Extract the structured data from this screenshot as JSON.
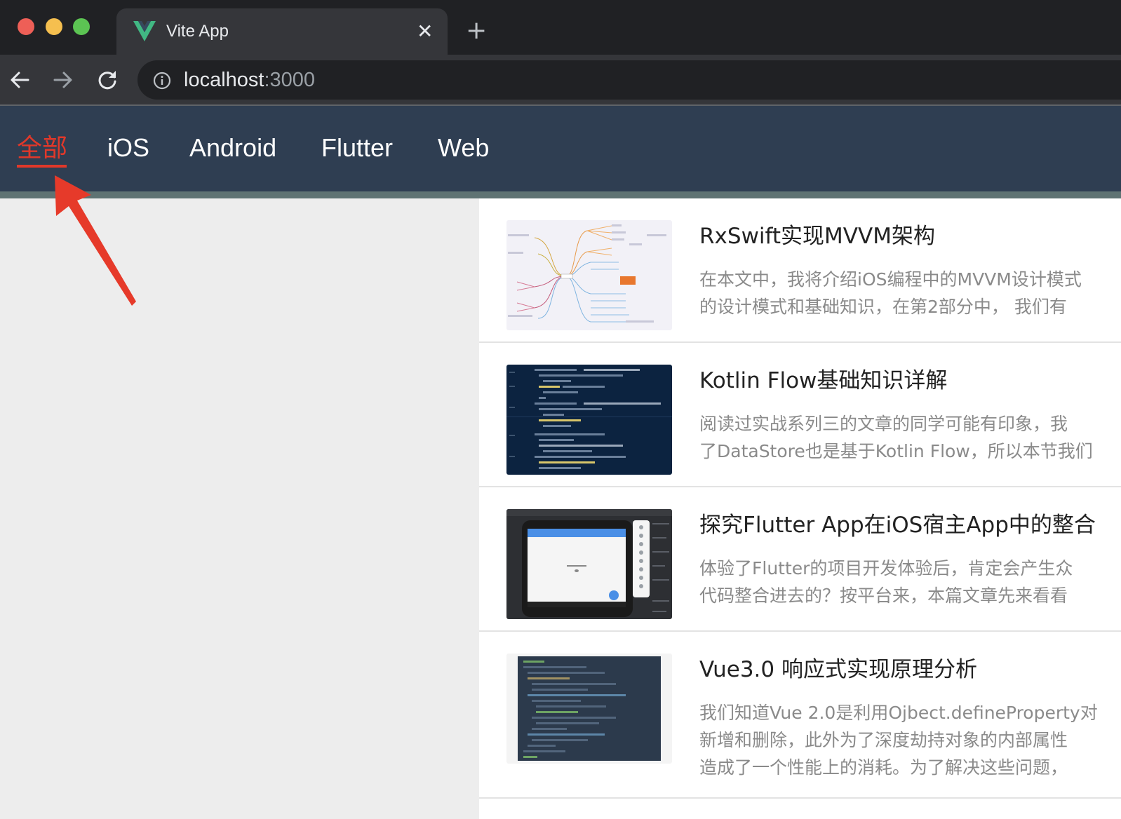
{
  "browser": {
    "tab_title": "Vite App",
    "url_host": "localhost",
    "url_port": ":3000",
    "close_glyph": "✕",
    "new_tab_glyph": "+"
  },
  "nav": {
    "items": [
      {
        "label": "全部",
        "active": true
      },
      {
        "label": "iOS",
        "active": false
      },
      {
        "label": "Android",
        "active": false
      },
      {
        "label": "Flutter",
        "active": false
      },
      {
        "label": "Web",
        "active": false
      }
    ],
    "active_color": "#e0382a",
    "background": "#2f3e52"
  },
  "annotation": {
    "icon": "red-arrow-icon",
    "color": "#e63a2a"
  },
  "articles": [
    {
      "title": "RxSwift实现MVVM架构",
      "desc_lines": [
        "在本文中，我将介绍iOS编程中的MVVM设计模式",
        "的设计模式和基础知识，在第2部分中， 我们有"
      ],
      "thumb": "mindmap"
    },
    {
      "title": "Kotlin Flow基础知识详解",
      "desc_lines": [
        "阅读过实战系列三的文章的同学可能有印象，我",
        "了DataStore也是基于Kotlin Flow，所以本节我们"
      ],
      "thumb": "code-editor"
    },
    {
      "title": "探究Flutter App在iOS宿主App中的整合",
      "desc_lines": [
        "体验了Flutter的项目开发体验后，肯定会产生众",
        "代码整合进去的？按平台来，本篇文章先来看看"
      ],
      "thumb": "phone-emulator"
    },
    {
      "title": "Vue3.0 响应式实现原理分析",
      "desc_lines": [
        "我们知道Vue 2.0是利用Ojbect.defineProperty对",
        "新增和删除，此外为了深度劫持对象的内部属性",
        "造成了一个性能上的消耗。为了解决这些问题，"
      ],
      "thumb": "code-screenshot"
    }
  ]
}
